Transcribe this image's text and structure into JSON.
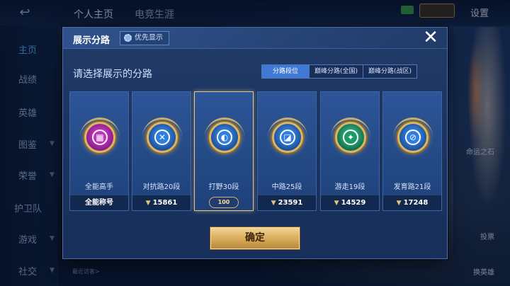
{
  "topbar": {
    "tabs": [
      "个人主页",
      "电竞生涯"
    ],
    "settings_label": "设置"
  },
  "sidebar": {
    "items": [
      {
        "label": "主页",
        "active": true
      },
      {
        "label": "战绩"
      },
      {
        "label": "英雄"
      },
      {
        "label": "图鉴"
      },
      {
        "label": "荣誉"
      },
      {
        "label": "护卫队"
      },
      {
        "label": "游戏"
      },
      {
        "label": "社交"
      }
    ]
  },
  "background": {
    "right_texts": [
      "命运之石",
      "投票",
      "换英雄"
    ],
    "bottom_hint": "最近访客>"
  },
  "modal": {
    "title": "展示分路",
    "priority_label": "优先显示",
    "close_glyph": "✕",
    "prompt": "请选择展示的分路",
    "filters": [
      {
        "label": "分路段位",
        "active": true
      },
      {
        "label": "巅峰分路(全国)"
      },
      {
        "label": "巅峰分路(战区)"
      }
    ],
    "cards": [
      {
        "label": "全能高手",
        "strip": "全能称号",
        "emblem": "purple",
        "glyph": "▦"
      },
      {
        "label": "对抗路20段",
        "strip": "15861",
        "emblem": "blue",
        "glyph": "✕"
      },
      {
        "label": "打野30段",
        "strip": "100",
        "emblem": "blue",
        "glyph": "◐",
        "selected": true
      },
      {
        "label": "中路25段",
        "strip": "23591",
        "emblem": "blue",
        "glyph": "◪"
      },
      {
        "label": "游走19段",
        "strip": "14529",
        "emblem": "green",
        "glyph": "✦"
      },
      {
        "label": "发育路21段",
        "strip": "17248",
        "emblem": "blue",
        "glyph": "⊘"
      }
    ],
    "confirm_label": "确定"
  },
  "colors": {
    "accent_gold": "#d9ae5c",
    "active_tab": "#3f79d6",
    "sidebar_active": "#5cb8ff"
  }
}
